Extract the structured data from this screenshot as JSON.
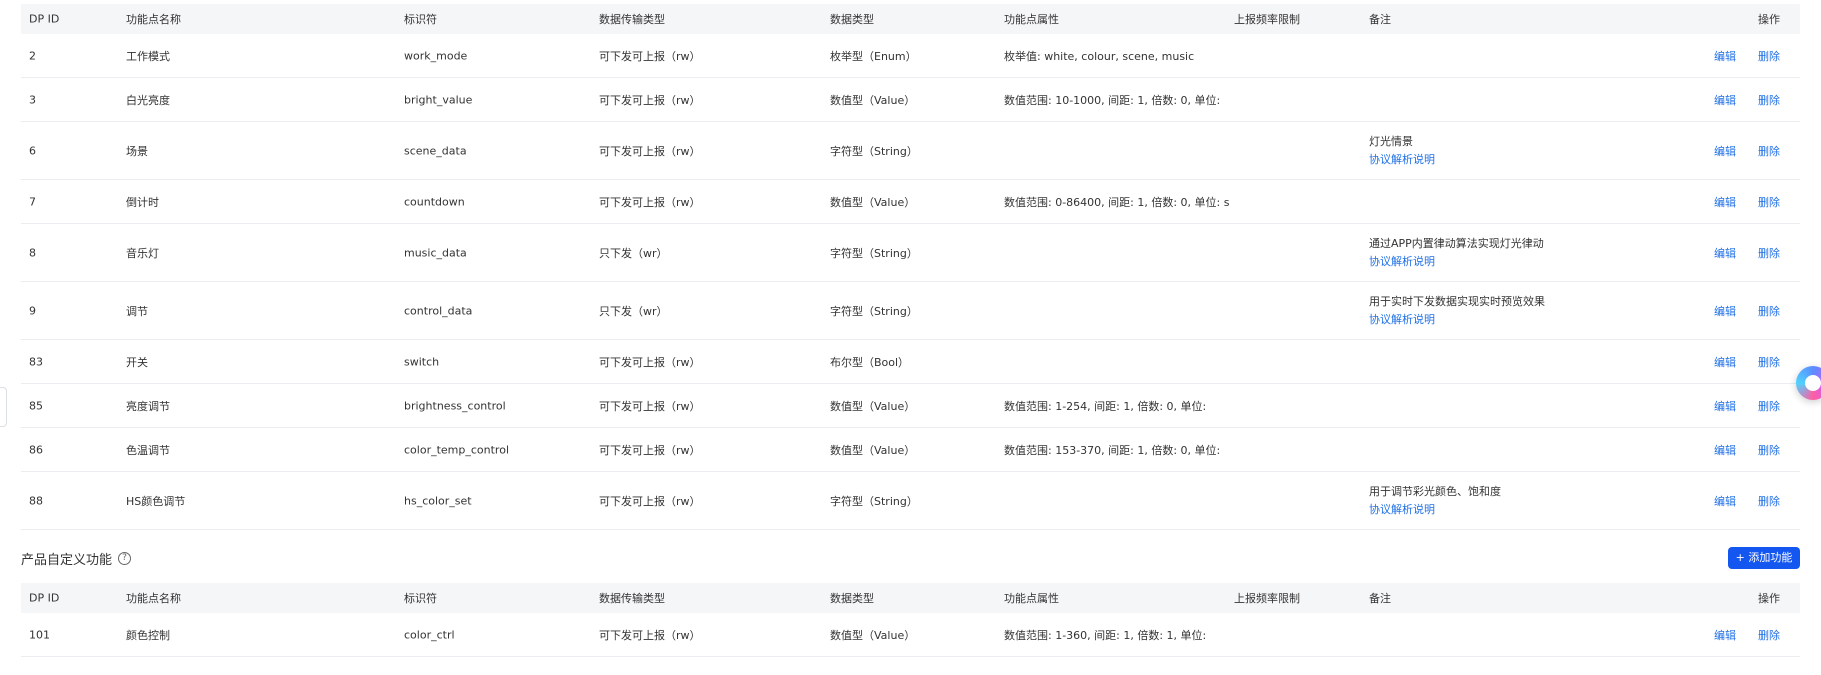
{
  "headers": [
    "DP ID",
    "功能点名称",
    "标识符",
    "数据传输类型",
    "数据类型",
    "功能点属性",
    "上报频率限制",
    "备注",
    "操作"
  ],
  "actions": {
    "edit": "编辑",
    "delete": "删除"
  },
  "standard_rows": [
    {
      "id": "2",
      "name": "工作模式",
      "code": "work_mode",
      "transfer": "可下发可上报（rw）",
      "type": "枚举型（Enum）",
      "attr": "枚举值: white, colour, scene, music",
      "note": "",
      "note_link": ""
    },
    {
      "id": "3",
      "name": "白光亮度",
      "code": "bright_value",
      "transfer": "可下发可上报（rw）",
      "type": "数值型（Value）",
      "attr": "数值范围: 10-1000, 间距: 1, 倍数: 0, 单位:",
      "note": "",
      "note_link": ""
    },
    {
      "id": "6",
      "name": "场景",
      "code": "scene_data",
      "transfer": "可下发可上报（rw）",
      "type": "字符型（String）",
      "attr": "",
      "note": "灯光情景",
      "note_link": "协议解析说明"
    },
    {
      "id": "7",
      "name": "倒计时",
      "code": "countdown",
      "transfer": "可下发可上报（rw）",
      "type": "数值型（Value）",
      "attr": "数值范围: 0-86400, 间距: 1, 倍数: 0, 单位: s",
      "note": "",
      "note_link": ""
    },
    {
      "id": "8",
      "name": "音乐灯",
      "code": "music_data",
      "transfer": "只下发（wr）",
      "type": "字符型（String）",
      "attr": "",
      "note": "通过APP内置律动算法实现灯光律动",
      "note_link": "协议解析说明"
    },
    {
      "id": "9",
      "name": "调节",
      "code": "control_data",
      "transfer": "只下发（wr）",
      "type": "字符型（String）",
      "attr": "",
      "note": "用于实时下发数据实现实时预览效果",
      "note_link": "协议解析说明"
    },
    {
      "id": "83",
      "name": "开关",
      "code": "switch",
      "transfer": "可下发可上报（rw）",
      "type": "布尔型（Bool）",
      "attr": "",
      "note": "",
      "note_link": ""
    },
    {
      "id": "85",
      "name": "亮度调节",
      "code": "brightness_control",
      "transfer": "可下发可上报（rw）",
      "type": "数值型（Value）",
      "attr": "数值范围: 1-254, 间距: 1, 倍数: 0, 单位:",
      "note": "",
      "note_link": ""
    },
    {
      "id": "86",
      "name": "色温调节",
      "code": "color_temp_control",
      "transfer": "可下发可上报（rw）",
      "type": "数值型（Value）",
      "attr": "数值范围: 153-370, 间距: 1, 倍数: 0, 单位:",
      "note": "",
      "note_link": ""
    },
    {
      "id": "88",
      "name": "HS颜色调节",
      "code": "hs_color_set",
      "transfer": "可下发可上报（rw）",
      "type": "字符型（String）",
      "attr": "",
      "note": "用于调节彩光颜色、饱和度",
      "note_link": "协议解析说明"
    }
  ],
  "custom_section": {
    "title": "产品自定义功能",
    "help_icon": "question-circle-icon",
    "add_label": "+ 添加功能"
  },
  "custom_rows": [
    {
      "id": "101",
      "name": "颜色控制",
      "code": "color_ctrl",
      "transfer": "可下发可上报（rw）",
      "type": "数值型（Value）",
      "attr": "数值范围: 1-360, 间距: 1, 倍数: 1, 单位:",
      "note": "",
      "note_link": ""
    }
  ],
  "colors": {
    "link": "#1f6fe5",
    "button": "#1456f0",
    "header_bg": "#f5f6f8"
  }
}
